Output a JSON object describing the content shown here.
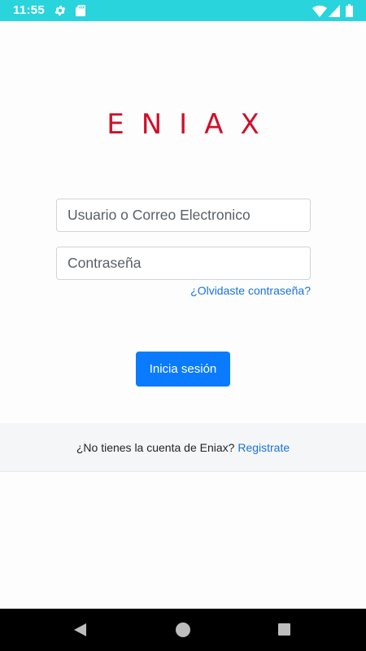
{
  "status_bar": {
    "time": "11:55",
    "icons": [
      "gear-icon",
      "sd-card-icon",
      "wifi-icon",
      "signal-icon",
      "battery-icon"
    ],
    "background": "#2ad4dc"
  },
  "logo": {
    "text": "ENIAX",
    "color": "#d0102a"
  },
  "login_form": {
    "user_placeholder": "Usuario o Correo Electronico",
    "password_placeholder": "Contraseña",
    "forgot_link": "¿Olvidaste contraseña?",
    "submit_label": "Inicia sesión",
    "submit_color": "#0a7bff"
  },
  "register": {
    "prompt": "¿No tienes la cuenta de Eniax?",
    "link": "Registrate"
  },
  "nav_bar": {
    "icons": [
      "back-icon",
      "home-icon",
      "recents-icon"
    ]
  }
}
